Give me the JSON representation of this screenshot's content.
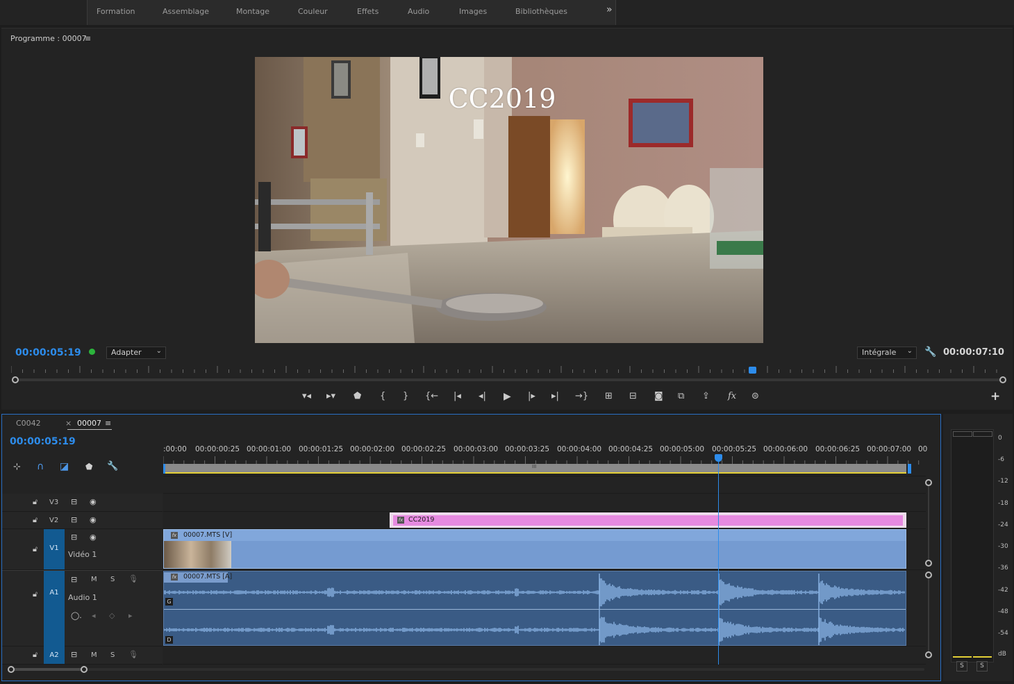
{
  "workspaces": [
    "Formation",
    "Assemblage",
    "Montage",
    "Couleur",
    "Effets",
    "Audio",
    "Images",
    "Bibliothèques"
  ],
  "workspace_more": "»",
  "program_monitor": {
    "title": "Programme : 00007",
    "menu_glyph": "≡",
    "video_title_text": "CC2019",
    "current_timecode": "00:00:05:19",
    "zoom_select": "Adapter",
    "quality_select": "Intégrale",
    "duration_timecode": "00:00:07:10"
  },
  "transport": {
    "buttons": [
      "mark-in",
      "mark-out",
      "add-marker",
      "go-to-in",
      "go-to-out",
      "clear-in-out",
      "go-to-in-point",
      "step-back",
      "play",
      "step-forward",
      "go-to-out-point",
      "insert",
      "lift",
      "extract",
      "export-frame",
      "compare",
      "export",
      "fx",
      "vr"
    ],
    "add_button": "+"
  },
  "timeline": {
    "tabs": [
      {
        "label": "C0042",
        "active": false,
        "close": ""
      },
      {
        "label": "00007",
        "active": true,
        "close": "×"
      }
    ],
    "menu_glyph": "≡",
    "current_timecode": "00:00:05:19",
    "ruler_labels": [
      ":00:00",
      "00:00:00:25",
      "00:00:01:00",
      "00:00:01:25",
      "00:00:02:00",
      "00:00:02:25",
      "00:00:03:00",
      "00:00:03:25",
      "00:00:04:00",
      "00:00:04:25",
      "00:00:05:00",
      "00:00:05:25",
      "00:00:06:00",
      "00:00:06:25",
      "00:00:07:00",
      "00"
    ],
    "tracks": {
      "v3": {
        "label": "V3"
      },
      "v2": {
        "label": "V2"
      },
      "v1": {
        "label": "V1",
        "target": "V1",
        "name": "Vidéo 1"
      },
      "a1": {
        "label": "A1",
        "target": "A1",
        "name": "Audio 1",
        "mute": "M",
        "solo": "S"
      },
      "a2": {
        "label": "A2",
        "target": "A2",
        "mute": "M",
        "solo": "S"
      }
    },
    "clips": {
      "title_clip": "CC2019",
      "video_clip": "00007.MTS [V]",
      "audio_clip": "00007.MTS [A]",
      "channel_left": "G",
      "channel_right": "D",
      "fx_badge": "fx"
    },
    "work_bar_grip": "III"
  },
  "audio_meter": {
    "scale": [
      "0",
      "-6",
      "-12",
      "-18",
      "-24",
      "-30",
      "-36",
      "-42",
      "-48",
      "-54",
      "dB"
    ],
    "solo_left": "S",
    "solo_right": "S"
  },
  "colors": {
    "accent_blue": "#2d8ceb",
    "title_clip": "#e68ae0",
    "video_clip": "#759bd1",
    "audio_clip": "#3a5b85",
    "waveform": "#84aede",
    "work_area": "#e3cf36"
  }
}
